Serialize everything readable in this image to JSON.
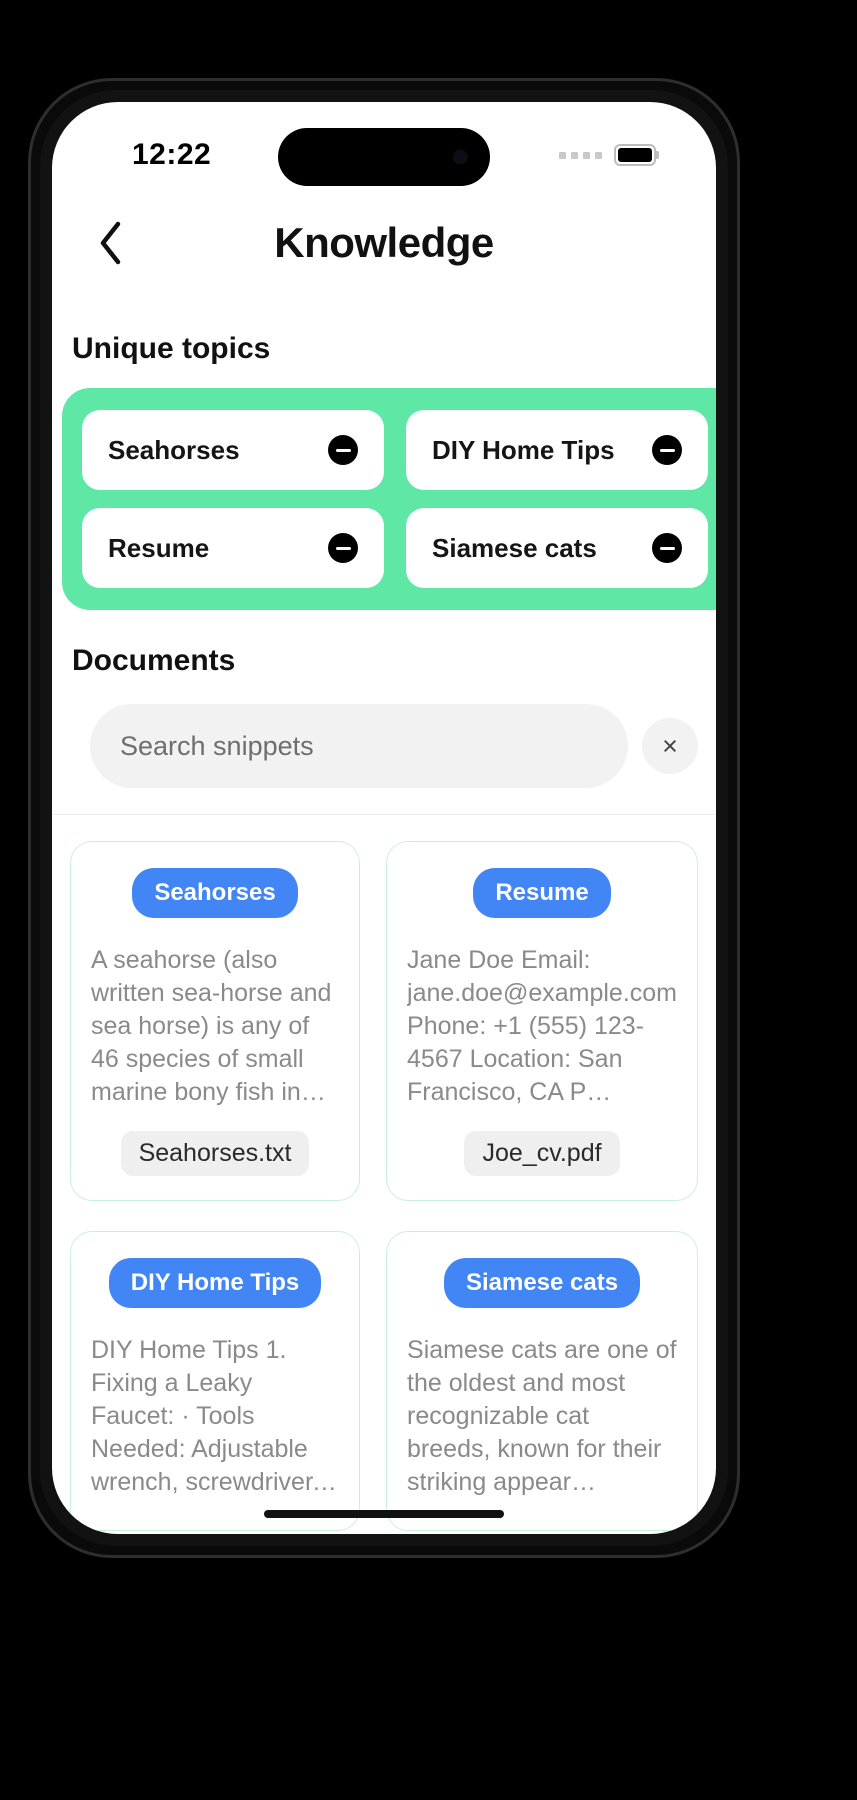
{
  "status_bar": {
    "time": "12:22",
    "signal_icon": "signal-dots-icon",
    "battery_icon": "battery-icon"
  },
  "nav": {
    "back_icon": "chevron-left-icon",
    "title": "Knowledge"
  },
  "topics_section": {
    "heading": "Unique topics",
    "panel_color": "#5FE8A5",
    "items": [
      {
        "label": "Seahorses",
        "remove_icon": "minus-circle-icon"
      },
      {
        "label": "DIY Home Tips",
        "remove_icon": "minus-circle-icon"
      },
      {
        "label": "Resume",
        "remove_icon": "minus-circle-icon"
      },
      {
        "label": "Siamese cats",
        "remove_icon": "minus-circle-icon"
      }
    ]
  },
  "documents_section": {
    "heading": "Documents",
    "search": {
      "placeholder": "Search snippets",
      "value": "",
      "clear_label": "×",
      "clear_icon": "close-icon"
    },
    "cards": [
      {
        "badge": "Seahorses",
        "snippet": "A seahorse (also written sea-horse and sea horse) is any of 46 species of small marine bony fish in t…",
        "filename": "Seahorses.txt"
      },
      {
        "badge": "Resume",
        "snippet": "Jane Doe Email: jane.doe@example.com Phone: +1 (555) 123-4567 Location: San Francisco, CA P…",
        "filename": "Joe_cv.pdf"
      },
      {
        "badge": "DIY Home Tips",
        "snippet": "DIY Home Tips 1. Fixing a Leaky Faucet: · Tools Needed: Adjustable wrench, screwdriver, replace…",
        "filename": ""
      },
      {
        "badge": "Siamese cats",
        "snippet": "Siamese cats are one of the oldest and most recognizable cat breeds, known for their striking appear…",
        "filename": ""
      }
    ]
  },
  "colors": {
    "accent_green": "#5FE8A5",
    "badge_blue": "#4285F4",
    "card_border": "#C9F0DD",
    "chip_grey": "#EFEFEF"
  }
}
